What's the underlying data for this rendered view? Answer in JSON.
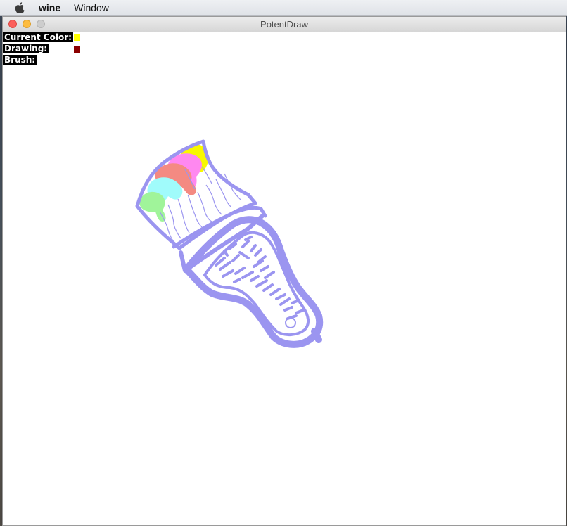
{
  "menubar": {
    "app_name": "wine",
    "items": [
      {
        "label": "Window"
      }
    ]
  },
  "window": {
    "title": "PotentDraw"
  },
  "hud": {
    "current_color_label": "Current Color:",
    "current_color_value": "#ffff00",
    "drawing_label": "Drawing:",
    "drawing_value": "#8b0000",
    "brush_label": "Brush:"
  },
  "colors": {
    "stroke": "#9b95f0",
    "yellow": "#f8f800",
    "magenta": "#ff88f0",
    "salmon": "#f48a82",
    "cyan": "#a0fbfb",
    "green": "#a0f49a"
  }
}
